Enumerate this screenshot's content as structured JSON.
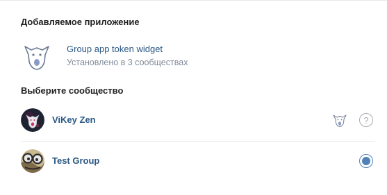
{
  "app_section": {
    "title": "Добавляемое приложение",
    "app_name": "Group app token widget",
    "app_status": "Установлено в 3 сообществах",
    "icon": "vk-dog-icon"
  },
  "groups_section": {
    "title": "Выберите сообщество",
    "groups": [
      {
        "name": "ViKey Zen",
        "avatar": "vikey-zen-avatar",
        "badge_icon": "vk-dog-icon",
        "action_icon": "question-icon",
        "action_symbol": "?",
        "selected": false
      },
      {
        "name": "Test Group",
        "avatar": "test-group-avatar",
        "action_icon": "radio-icon",
        "selected": true
      }
    ]
  },
  "colors": {
    "link": "#2a5885",
    "secondary_text": "#818c99",
    "accent": "#5181b8",
    "divider": "#e7e8ec"
  }
}
